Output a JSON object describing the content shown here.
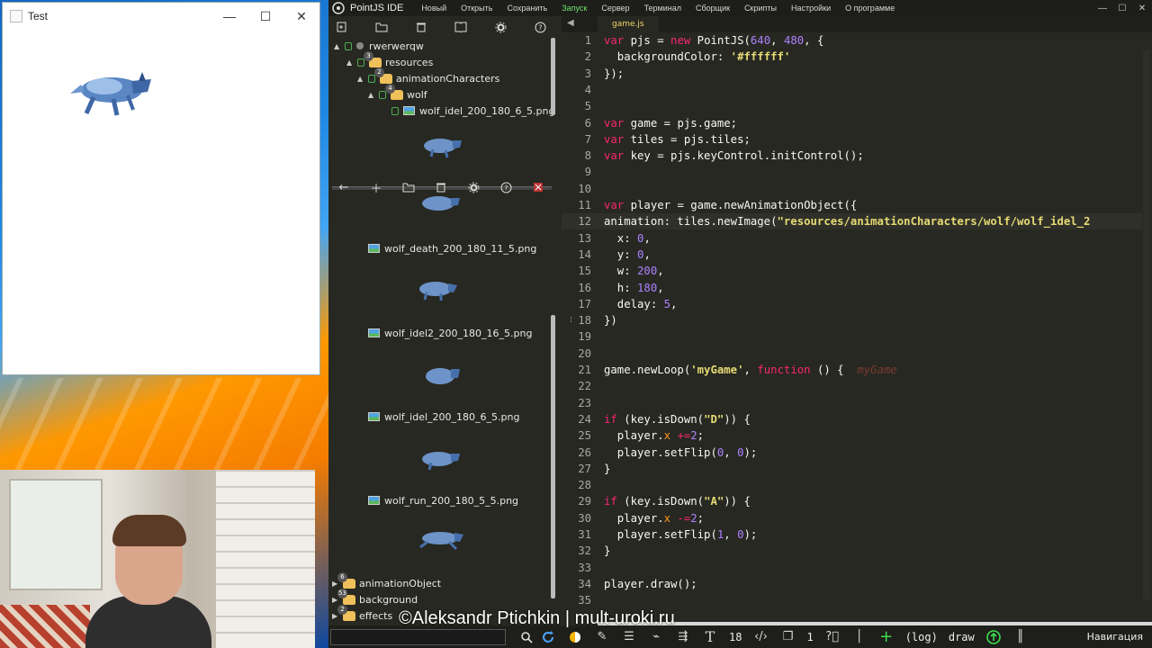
{
  "test_window": {
    "title": "Test",
    "minimize": "—",
    "maximize": "☐",
    "close": "✕"
  },
  "ide": {
    "title": "PointJS IDE",
    "menu": [
      {
        "label": "Новый"
      },
      {
        "label": "Открыть"
      },
      {
        "label": "Сохранить"
      },
      {
        "label": "Запуск",
        "active": true
      },
      {
        "label": "Сервер"
      },
      {
        "label": "Терминал"
      },
      {
        "label": "Сборщик"
      },
      {
        "label": "Скрипты"
      },
      {
        "label": "Настройки"
      },
      {
        "label": "О программе"
      }
    ],
    "window_buttons": {
      "minimize": "—",
      "maximize": "☐",
      "close": "✕"
    },
    "top_toolbar_icons": [
      "new-file-icon",
      "new-folder-icon",
      "trash-icon",
      "book-icon",
      "gear-icon",
      "help-icon"
    ],
    "tree": [
      {
        "label": "rwerwerqw",
        "badge": ""
      },
      {
        "label": "resources",
        "badge": "3"
      },
      {
        "label": "animationCharacters",
        "badge": "2"
      },
      {
        "label": "wolf",
        "badge": "4"
      },
      {
        "label": "wolf_idel_200_180_6_5.png",
        "badge": ""
      }
    ],
    "lower_toolbar_icons": [
      "back-arrow-icon",
      "plus-icon",
      "folder-icon",
      "trash-icon",
      "gear-icon",
      "help-icon",
      "close-red-icon"
    ],
    "files": [
      {
        "label": "wolf_death_200_180_11_5.png"
      },
      {
        "label": "wolf_idel2_200_180_16_5.png"
      },
      {
        "label": "wolf_idel_200_180_6_5.png"
      },
      {
        "label": "wolf_run_200_180_5_5.png"
      }
    ],
    "bottom_tree": [
      {
        "label": "animationObject",
        "badge": "6"
      },
      {
        "label": "background",
        "badge": "53"
      },
      {
        "label": "effects",
        "badge": "2"
      }
    ],
    "editor": {
      "tab": "game.js",
      "lines": [
        {
          "n": "1"
        },
        {
          "n": "2"
        },
        {
          "n": "3"
        },
        {
          "n": "4"
        },
        {
          "n": "5"
        },
        {
          "n": "6"
        },
        {
          "n": "7"
        },
        {
          "n": "8"
        },
        {
          "n": "9"
        },
        {
          "n": "10"
        },
        {
          "n": "11"
        },
        {
          "n": "12"
        },
        {
          "n": "13"
        },
        {
          "n": "14"
        },
        {
          "n": "15"
        },
        {
          "n": "16"
        },
        {
          "n": "17"
        },
        {
          "n": "18"
        },
        {
          "n": "19"
        },
        {
          "n": "20"
        },
        {
          "n": "21"
        },
        {
          "n": "22"
        },
        {
          "n": "23"
        },
        {
          "n": "24"
        },
        {
          "n": "25"
        },
        {
          "n": "26"
        },
        {
          "n": "27"
        },
        {
          "n": "28"
        },
        {
          "n": "29"
        },
        {
          "n": "30"
        },
        {
          "n": "31"
        },
        {
          "n": "32"
        },
        {
          "n": "33"
        },
        {
          "n": "34"
        },
        {
          "n": "35"
        }
      ],
      "code": {
        "l1_a": "var ",
        "l1_b": "pjs = ",
        "l1_c": "new ",
        "l1_d": "PointJS(",
        "l1_e": "640",
        "l1_f": ", ",
        "l1_g": "480",
        "l1_h": ", {",
        "l2_a": "  backgroundColor: ",
        "l2_b": "'#ffffff'",
        "l3": "});",
        "l6_a": "var ",
        "l6_b": "game = pjs.game;",
        "l7_a": "var ",
        "l7_b": "tiles = pjs.tiles;",
        "l8_a": "var ",
        "l8_b": "key = pjs.keyControl.initControl();",
        "l11_a": "var ",
        "l11_b": "player = game.newAnimationObject({",
        "l12_a": "animation: tiles.newImage(",
        "l12_b": "\"resources/animationCharacters/wolf/wolf_idel_2",
        "l13_a": "  x: ",
        "l13_b": "0",
        "l13_c": ",",
        "l14_a": "  y: ",
        "l14_b": "0",
        "l14_c": ",",
        "l15_a": "  w: ",
        "l15_b": "200",
        "l15_c": ",",
        "l16_a": "  h: ",
        "l16_b": "180",
        "l16_c": ",",
        "l17_a": "  delay: ",
        "l17_b": "5",
        "l17_c": ",",
        "l18": "})",
        "l21_a": "game.newLoop(",
        "l21_b": "'myGame'",
        "l21_c": ", ",
        "l21_d": "function ",
        "l21_e": "() {",
        "l21_f": "  myGame",
        "l24_a": "if ",
        "l24_b": "(key.isDown(",
        "l24_c": "\"D\"",
        "l24_d": ")) {",
        "l25_a": "  player.",
        "l25_b": "x",
        "l25_c": " +=",
        "l25_d": "2",
        "l25_e": ";",
        "l26_a": "  player.setFlip(",
        "l26_b": "0",
        "l26_c": ", ",
        "l26_d": "0",
        "l26_e": ");",
        "l27": "}",
        "l29_a": "if ",
        "l29_b": "(key.isDown(",
        "l29_c": "\"A\"",
        "l29_d": ")) {",
        "l30_a": "  player.",
        "l30_b": "x",
        "l30_c": " -=",
        "l30_d": "2",
        "l30_e": ";",
        "l31_a": "  player.setFlip(",
        "l31_b": "1",
        "l31_c": ", ",
        "l31_d": "0",
        "l31_e": ");",
        "l32": "}",
        "l34": "player.draw();"
      }
    },
    "status": {
      "font_size": "18",
      "cursor_count": "1",
      "log_label": "(log)",
      "draw_label": "draw",
      "nav_label": "Навигация"
    }
  },
  "watermark": "©Aleksandr Ptichkin | mult-uroki.ru"
}
